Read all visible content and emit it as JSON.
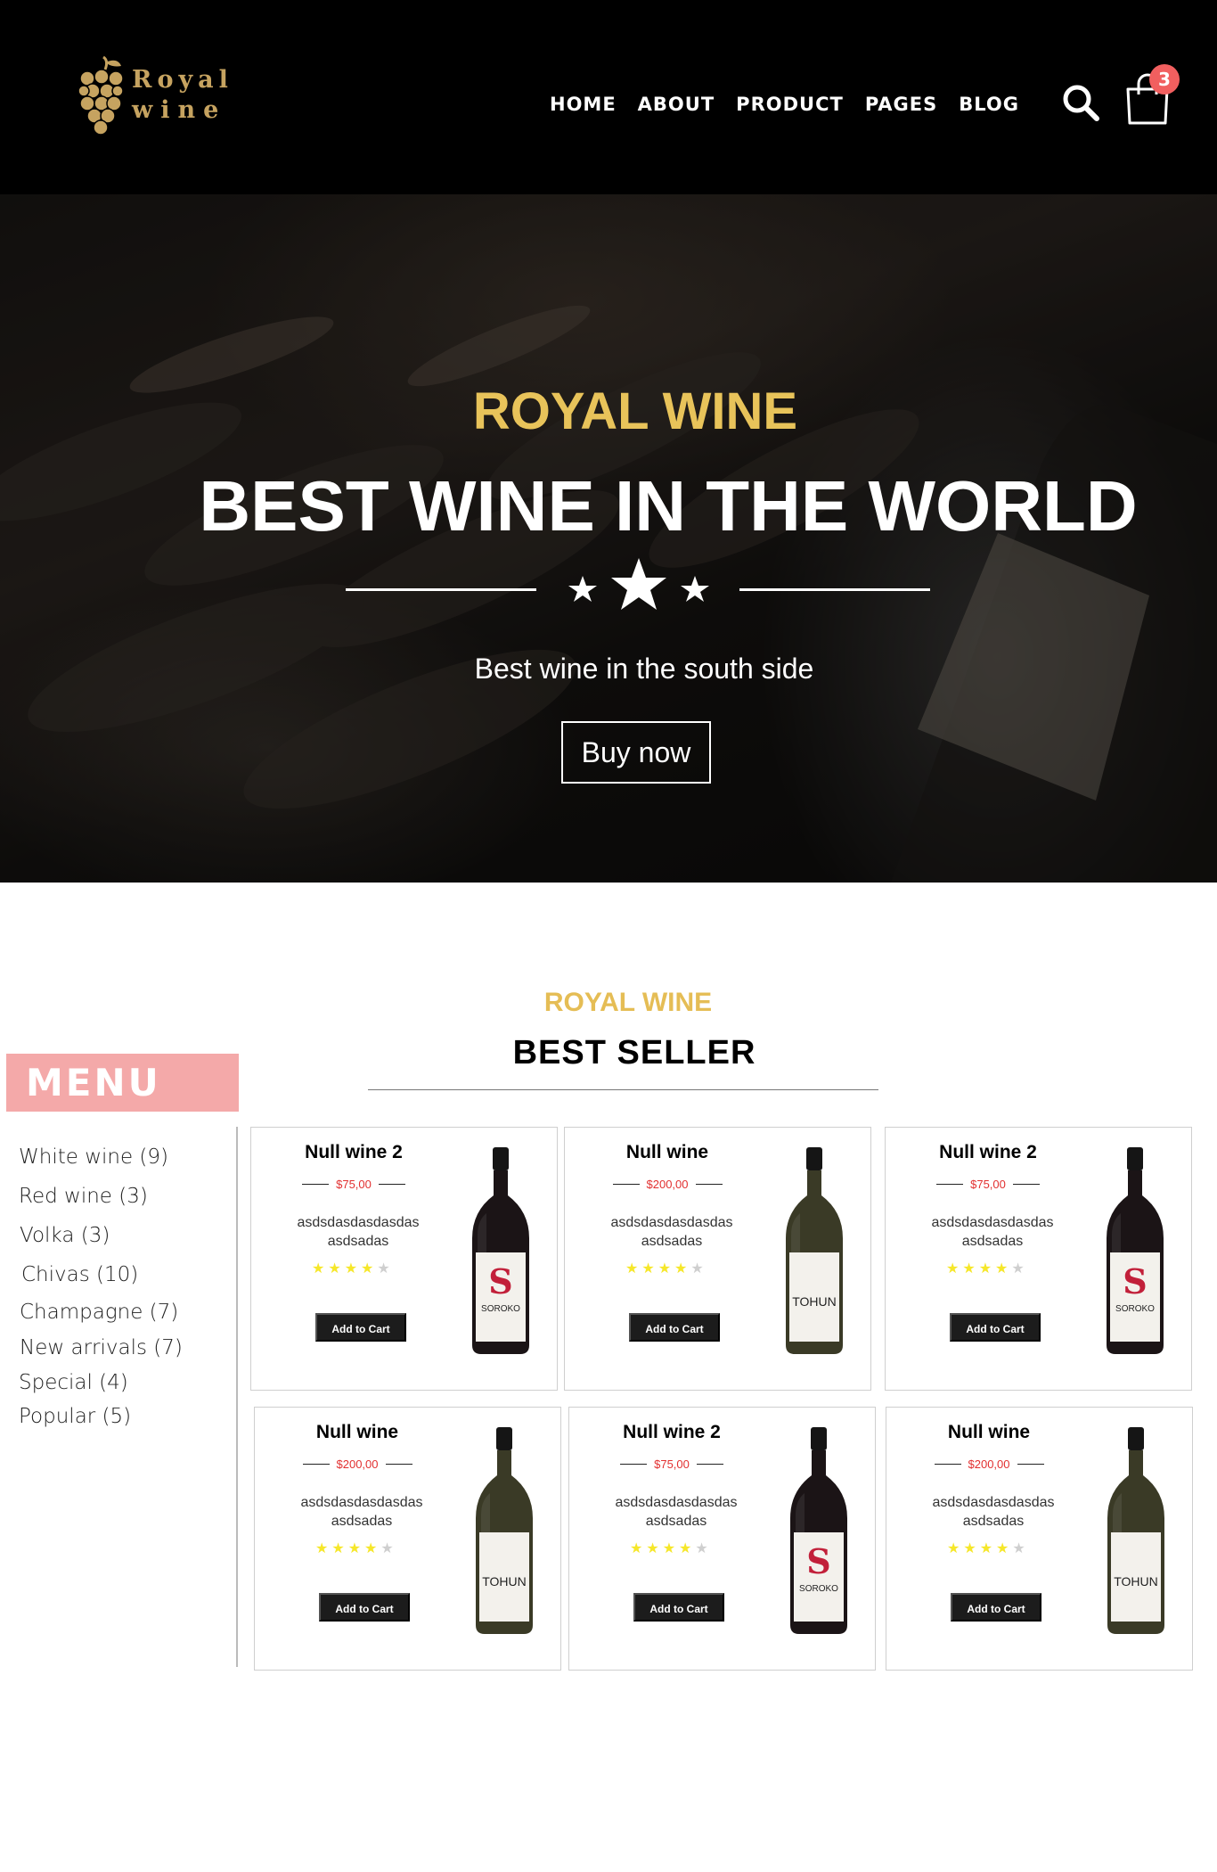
{
  "brand": {
    "line1": "Royal",
    "line2": "wine",
    "color": "#c6a360"
  },
  "nav": {
    "items": [
      "HOME",
      "ABOUT",
      "PRODUCT",
      "PAGES",
      "BLOG"
    ]
  },
  "cart": {
    "count": "3",
    "icon": "shopping-bag-icon",
    "badge_color": "#f15f5f"
  },
  "search": {
    "icon": "search-icon"
  },
  "hero": {
    "kicker": "ROYAL WINE",
    "title": "BEST WINE IN THE WORLD",
    "subtitle": "Best wine in the south side",
    "button": "Buy now",
    "kicker_color": "#e8c35a"
  },
  "section": {
    "kicker": "ROYAL WINE",
    "title": "BEST SELLER"
  },
  "menu": {
    "title": "MENU",
    "header_color": "#f4a9a9",
    "items": [
      "White wine (9)",
      "Red wine (3)",
      "Volka (3)",
      "Chivas (10)",
      "Champagne (7)",
      "New arrivals (7)",
      "Special (4)",
      "Popular (5)"
    ]
  },
  "products": [
    {
      "name": "Null wine 2",
      "price": "$75,00",
      "desc_line1": "asdsdasdasdasdas",
      "desc_line2": "asdsadas",
      "rating": 4,
      "button": "Add to Cart",
      "bottle": "red-soroko-bottle"
    },
    {
      "name": "Null wine",
      "price": "$200,00",
      "desc_line1": "asdsdasdasdasdas",
      "desc_line2": "asdsadas",
      "rating": 4,
      "button": "Add to Cart",
      "bottle": "white-tohun-bottle"
    },
    {
      "name": "Null wine 2",
      "price": "$75,00",
      "desc_line1": "asdsdasdasdasdas",
      "desc_line2": "asdsadas",
      "rating": 4,
      "button": "Add to Cart",
      "bottle": "red-soroko-bottle"
    },
    {
      "name": "Null wine",
      "price": "$200,00",
      "desc_line1": "asdsdasdasdasdas",
      "desc_line2": "asdsadas",
      "rating": 4,
      "button": "Add to Cart",
      "bottle": "white-tohun-bottle"
    },
    {
      "name": "Null wine 2",
      "price": "$75,00",
      "desc_line1": "asdsdasdasdasdas",
      "desc_line2": "asdsadas",
      "rating": 4,
      "button": "Add to Cart",
      "bottle": "red-soroko-bottle"
    },
    {
      "name": "Null wine",
      "price": "$200,00",
      "desc_line1": "asdsdasdasdasdas",
      "desc_line2": "asdsadas",
      "rating": 4,
      "button": "Add to Cart",
      "bottle": "white-tohun-bottle"
    }
  ],
  "bottle_labels": {
    "red": "SOROKO",
    "white": "TOHUN"
  },
  "colors": {
    "price": "#e23030",
    "star_on": "#f6e72a",
    "star_off": "#cfcfcf"
  }
}
